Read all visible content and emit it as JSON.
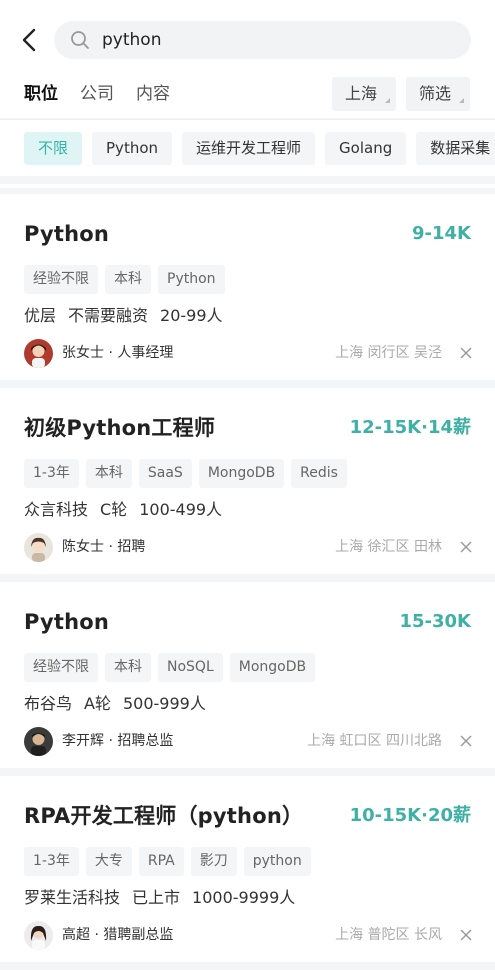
{
  "search": {
    "query": "python"
  },
  "tabs": [
    "职位",
    "公司",
    "内容"
  ],
  "city_filter": "上海",
  "more_filter": "筛选",
  "chips": [
    "不限",
    "Python",
    "运维开发工程师",
    "Golang",
    "数据采集"
  ],
  "jobs": [
    {
      "title": "Python",
      "salary": "9-14K",
      "tags": [
        "经验不限",
        "本科",
        "Python"
      ],
      "company": "优层",
      "funding": "不需要融资",
      "size": "20-99人",
      "recruiter": "张女士 · 人事经理",
      "location": "上海 闵行区 吴泾"
    },
    {
      "title": "初级Python工程师",
      "salary": "12-15K·14薪",
      "tags": [
        "1-3年",
        "本科",
        "SaaS",
        "MongoDB",
        "Redis"
      ],
      "company": "众言科技",
      "funding": "C轮",
      "size": "100-499人",
      "recruiter": "陈女士 · 招聘",
      "location": "上海 徐汇区 田林"
    },
    {
      "title": "Python",
      "salary": "15-30K",
      "tags": [
        "经验不限",
        "本科",
        "NoSQL",
        "MongoDB"
      ],
      "company": "布谷鸟",
      "funding": "A轮",
      "size": "500-999人",
      "recruiter": "李开辉 · 招聘总监",
      "location": "上海 虹口区 四川北路"
    },
    {
      "title": "RPA开发工程师（python）",
      "salary": "10-15K·20薪",
      "tags": [
        "1-3年",
        "大专",
        "RPA",
        "影刀",
        "python"
      ],
      "company": "罗莱生活科技",
      "funding": "已上市",
      "size": "1000-9999人",
      "recruiter": "高超 · 猎聘副总监",
      "location": "上海 普陀区 长风"
    }
  ],
  "colors": {
    "accent": "#3fb0a4",
    "chip_active_bg": "#dff5f5",
    "page_bg": "#f4f5f6"
  }
}
